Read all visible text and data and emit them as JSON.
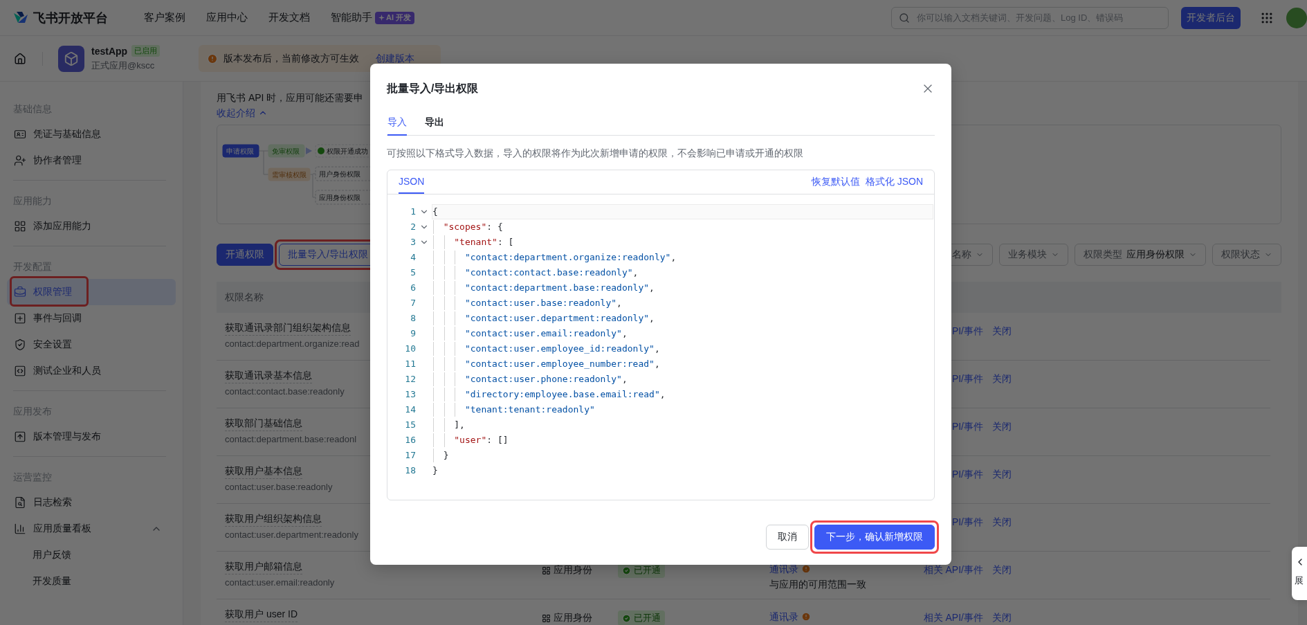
{
  "topnav": {
    "logo": "飞书开放平台",
    "links": [
      {
        "label": "客户案例"
      },
      {
        "label": "应用中心"
      },
      {
        "label": "开发文档"
      },
      {
        "label": "智能助手",
        "badge": "AI 开发"
      }
    ],
    "search": {
      "placeholder": "你可以输入文档关键词、开发问题、Log ID、错误码"
    },
    "console_button": "开发者后台"
  },
  "app_header": {
    "name": "testApp",
    "status": "已启用",
    "subtitle": "正式应用@kscc",
    "notice": {
      "text": "版本发布后，当前修改方可生效",
      "link": "创建版本"
    }
  },
  "sidebar": {
    "sections": [
      {
        "title": "基础信息",
        "items": [
          {
            "label": "凭证与基础信息",
            "selected": false,
            "highlighted": false
          },
          {
            "label": "协作者管理",
            "selected": false,
            "highlighted": false
          }
        ]
      },
      {
        "title": "应用能力",
        "items": [
          {
            "label": "添加应用能力",
            "selected": false,
            "highlighted": false
          }
        ]
      },
      {
        "title": "开发配置",
        "items": [
          {
            "label": "权限管理",
            "selected": true,
            "highlighted": true
          },
          {
            "label": "事件与回调",
            "selected": false,
            "highlighted": false
          },
          {
            "label": "安全设置",
            "selected": false,
            "highlighted": false
          },
          {
            "label": "测试企业和人员",
            "selected": false,
            "highlighted": false
          }
        ]
      },
      {
        "title": "应用发布",
        "items": [
          {
            "label": "版本管理与发布",
            "selected": false,
            "highlighted": false
          }
        ]
      },
      {
        "title": "运营监控",
        "items": [
          {
            "label": "日志检索",
            "selected": false,
            "highlighted": false
          },
          {
            "label": "应用质量看板",
            "selected": false,
            "highlighted": false,
            "expanded": true,
            "children": [
              {
                "label": "用户反馈",
                "selected": false,
                "highlighted": false
              },
              {
                "label": "开发质量",
                "selected": false,
                "highlighted": false
              }
            ]
          }
        ]
      }
    ]
  },
  "intro": {
    "text": "用飞书 API 时，应用可能还需要申",
    "toggle": "收起介绍"
  },
  "flow_diagram": {
    "steps": [
      {
        "label": "申请权限",
        "kind": "request"
      },
      {
        "label": "免审权限",
        "kind": "auto"
      },
      {
        "label": "权限开通成功",
        "kind": "success"
      },
      {
        "label": "需审核权限",
        "kind": "review"
      },
      {
        "label": "用户身份权限",
        "kind": "pending"
      },
      {
        "label": "应用身份权限",
        "kind": "pending"
      }
    ]
  },
  "toolbar": {
    "buttons": [
      {
        "label": "开通权限",
        "kind": "primary",
        "highlighted": false
      },
      {
        "label": "批量导入/导出权限",
        "kind": "outline",
        "highlighted": true
      }
    ],
    "filters": [
      {
        "label": "名称"
      },
      {
        "label": "业务模块"
      },
      {
        "label": "权限类型",
        "value": "应用身份权限"
      },
      {
        "label": "权限状态"
      }
    ]
  },
  "table": {
    "columns": [
      {
        "label": "权限名称"
      }
    ],
    "rows": [
      {
        "name": "获取通讯录部门组织架构信息",
        "scope": "contact:department.organize:read",
        "actions": [
          "PI/事件",
          "关闭"
        ]
      },
      {
        "name": "获取通讯录基本信息",
        "scope": "contact:contact.base:readonly",
        "actions": [
          "PI/事件",
          "关闭"
        ]
      },
      {
        "name": "获取部门基础信息",
        "scope": "contact:department.base:readonl",
        "actions": [
          "PI/事件",
          "关闭"
        ]
      },
      {
        "name": "获取用户基本信息",
        "scope": "contact:user.base:readonly",
        "actions": [
          "PI/事件",
          "关闭"
        ]
      },
      {
        "name": "获取用户组织架构信息",
        "scope": "contact:user.department:readonly",
        "actions": [
          "PI/事件",
          "关闭"
        ]
      },
      {
        "name": "获取用户邮箱信息",
        "scope": "contact:user.email:readonly",
        "identity": "应用身份",
        "status": "已开通",
        "range": "通讯录",
        "range_note": "与应用的可用范围一致",
        "actions": [
          "相关 API/事件",
          "关闭"
        ]
      },
      {
        "name": "获取用户 user ID",
        "identity": "应用身份",
        "status": "已开通",
        "range": "通讯录",
        "actions": [
          "相关 API/事件",
          "关闭"
        ]
      }
    ]
  },
  "side_tab": {
    "label": "展"
  },
  "dialog": {
    "title": "批量导入/导出权限",
    "tabs": [
      {
        "label": "导入",
        "selected": true
      },
      {
        "label": "导出",
        "selected": false
      }
    ],
    "description": "可按照以下格式导入数据，导入的权限将作为此次新增申请的权限，不会影响已申请或开通的权限",
    "editor": {
      "tabs": [
        {
          "label": "JSON",
          "selected": true
        }
      ],
      "actions": [
        {
          "label": "恢复默认值"
        },
        {
          "label": "格式化 JSON"
        }
      ],
      "lines": [
        {
          "number": "1",
          "foldable": true,
          "active": true,
          "tokens": [
            {
              "kind": "punct",
              "text": "{"
            }
          ]
        },
        {
          "number": "2",
          "foldable": true,
          "active": false,
          "tokens": [
            {
              "kind": "key",
              "text": "  \"scopes\""
            },
            {
              "kind": "punct",
              "text": ": {"
            }
          ]
        },
        {
          "number": "3",
          "foldable": true,
          "active": false,
          "tokens": [
            {
              "kind": "key",
              "text": "    \"tenant\""
            },
            {
              "kind": "punct",
              "text": ": ["
            }
          ]
        },
        {
          "number": "4",
          "foldable": false,
          "active": false,
          "tokens": [
            {
              "kind": "string",
              "text": "      \"contact:department.organize:readonly\""
            },
            {
              "kind": "punct",
              "text": ","
            }
          ]
        },
        {
          "number": "5",
          "foldable": false,
          "active": false,
          "tokens": [
            {
              "kind": "string",
              "text": "      \"contact:contact.base:readonly\""
            },
            {
              "kind": "punct",
              "text": ","
            }
          ]
        },
        {
          "number": "6",
          "foldable": false,
          "active": false,
          "tokens": [
            {
              "kind": "string",
              "text": "      \"contact:department.base:readonly\""
            },
            {
              "kind": "punct",
              "text": ","
            }
          ]
        },
        {
          "number": "7",
          "foldable": false,
          "active": false,
          "tokens": [
            {
              "kind": "string",
              "text": "      \"contact:user.base:readonly\""
            },
            {
              "kind": "punct",
              "text": ","
            }
          ]
        },
        {
          "number": "8",
          "foldable": false,
          "active": false,
          "tokens": [
            {
              "kind": "string",
              "text": "      \"contact:user.department:readonly\""
            },
            {
              "kind": "punct",
              "text": ","
            }
          ]
        },
        {
          "number": "9",
          "foldable": false,
          "active": false,
          "tokens": [
            {
              "kind": "string",
              "text": "      \"contact:user.email:readonly\""
            },
            {
              "kind": "punct",
              "text": ","
            }
          ]
        },
        {
          "number": "10",
          "foldable": false,
          "active": false,
          "tokens": [
            {
              "kind": "string",
              "text": "      \"contact:user.employee_id:readonly\""
            },
            {
              "kind": "punct",
              "text": ","
            }
          ]
        },
        {
          "number": "11",
          "foldable": false,
          "active": false,
          "tokens": [
            {
              "kind": "string",
              "text": "      \"contact:user.employee_number:read\""
            },
            {
              "kind": "punct",
              "text": ","
            }
          ]
        },
        {
          "number": "12",
          "foldable": false,
          "active": false,
          "tokens": [
            {
              "kind": "string",
              "text": "      \"contact:user.phone:readonly\""
            },
            {
              "kind": "punct",
              "text": ","
            }
          ]
        },
        {
          "number": "13",
          "foldable": false,
          "active": false,
          "tokens": [
            {
              "kind": "string",
              "text": "      \"directory:employee.base.email:read\""
            },
            {
              "kind": "punct",
              "text": ","
            }
          ]
        },
        {
          "number": "14",
          "foldable": false,
          "active": false,
          "tokens": [
            {
              "kind": "string",
              "text": "      \"tenant:tenant:readonly\""
            }
          ]
        },
        {
          "number": "15",
          "foldable": false,
          "active": false,
          "tokens": [
            {
              "kind": "punct",
              "text": "    ],"
            }
          ]
        },
        {
          "number": "16",
          "foldable": false,
          "active": false,
          "tokens": [
            {
              "kind": "key",
              "text": "    \"user\""
            },
            {
              "kind": "punct",
              "text": ": []"
            }
          ]
        },
        {
          "number": "17",
          "foldable": false,
          "active": false,
          "tokens": [
            {
              "kind": "punct",
              "text": "  }"
            }
          ]
        },
        {
          "number": "18",
          "foldable": false,
          "active": false,
          "tokens": [
            {
              "kind": "punct",
              "text": "}"
            }
          ]
        }
      ]
    },
    "buttons": [
      {
        "label": "取消",
        "kind": "secondary",
        "highlighted": false
      },
      {
        "label": "下一步，确认新增权限",
        "kind": "primary",
        "highlighted": true
      }
    ]
  }
}
